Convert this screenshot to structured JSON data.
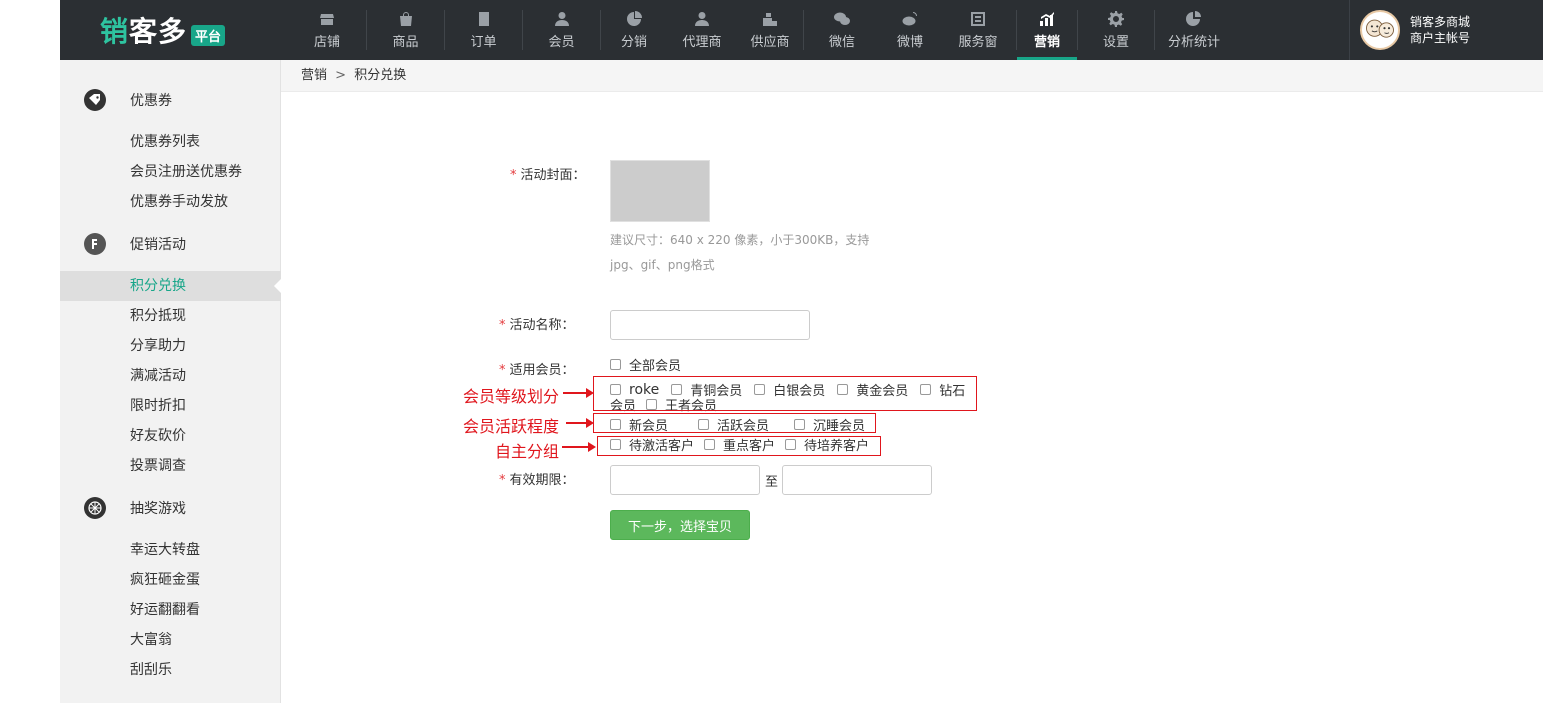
{
  "logo": {
    "main": "销客多",
    "badge": "平台"
  },
  "nav": [
    {
      "label": "店铺",
      "icon": "store-icon"
    },
    {
      "label": "商品",
      "icon": "bag-icon"
    },
    {
      "label": "订单",
      "icon": "order-icon"
    },
    {
      "label": "会员",
      "icon": "member-icon"
    },
    {
      "label": "分销",
      "icon": "distribution-icon"
    },
    {
      "label": "代理商",
      "icon": "agent-icon"
    },
    {
      "label": "供应商",
      "icon": "supplier-icon"
    },
    {
      "label": "微信",
      "icon": "wechat-icon"
    },
    {
      "label": "微博",
      "icon": "weibo-icon"
    },
    {
      "label": "服务窗",
      "icon": "service-window-icon"
    },
    {
      "label": "营销",
      "icon": "marketing-icon",
      "active": true
    },
    {
      "label": "设置",
      "icon": "gear-icon"
    },
    {
      "label": "分析统计",
      "icon": "analytics-icon"
    }
  ],
  "user": {
    "line1": "销客多商城",
    "line2": "商户主帐号"
  },
  "sidebar": {
    "groups": [
      {
        "label": "优惠券",
        "icon": "coupon-icon",
        "items": [
          "优惠券列表",
          "会员注册送优惠券",
          "优惠券手动发放"
        ]
      },
      {
        "label": "促销活动",
        "icon": "promotion-icon",
        "items": [
          "积分兑换",
          "积分抵现",
          "分享助力",
          "满减活动",
          "限时折扣",
          "好友砍价",
          "投票调查"
        ]
      },
      {
        "label": "抽奖游戏",
        "icon": "lottery-icon",
        "items": [
          "幸运大转盘",
          "疯狂砸金蛋",
          "好运翻翻看",
          "大富翁",
          "刮刮乐"
        ]
      }
    ],
    "active_item": "积分兑换"
  },
  "breadcrumb": {
    "parent": "营销",
    "separator": ">",
    "current": "积分兑换"
  },
  "form": {
    "cover_label": "活动封面：",
    "cover_hint_line1": "建议尺寸：640 x 220 像素，小于300KB，支持",
    "cover_hint_line2": "jpg、gif、png格式",
    "name_label": "活动名称：",
    "name_value": "",
    "members_label": "适用会员：",
    "all_members": "全部会员",
    "level_options": [
      "roke",
      "青铜会员",
      "白银会员",
      "黄金会员",
      "钻石会员",
      "王者会员"
    ],
    "activity_options": [
      "新会员",
      "活跃会员",
      "沉睡会员"
    ],
    "group_options": [
      "待激活客户",
      "重点客户",
      "待培养客户"
    ],
    "validity_label": "有效期限：",
    "validity_to": "至",
    "validity_start": "",
    "validity_end": "",
    "next_button": "下一步，选择宝贝",
    "required_mark": "*"
  },
  "annotations": {
    "level": "会员等级划分",
    "activity": "会员活跃程度",
    "group": "自主分组"
  },
  "colors": {
    "topbar": "#2b2f33",
    "accent": "#18a689",
    "annotation": "#e0161d",
    "button": "#5cb85c"
  }
}
